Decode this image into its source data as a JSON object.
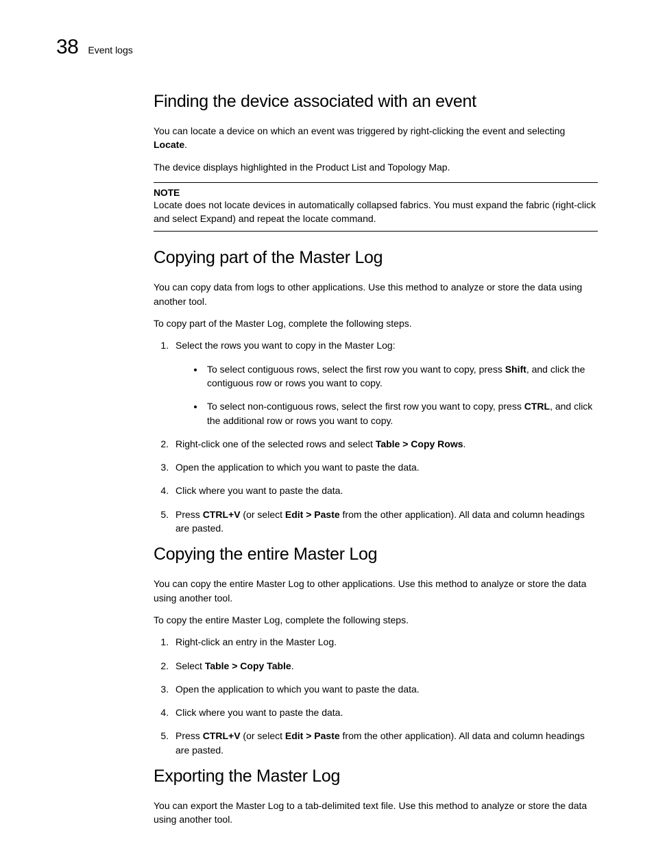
{
  "header": {
    "pageNumber": "38",
    "sectionTitle": "Event logs"
  },
  "sections": {
    "finding": {
      "heading": "Finding the device associated with an event",
      "p1a": "You can locate a device on which an event was triggered by right-clicking the event and selecting ",
      "p1b": "Locate",
      "p1c": ".",
      "p2": "The device displays highlighted in the Product List and Topology Map.",
      "noteLabel": "NOTE",
      "noteText": "Locate does not locate devices in automatically collapsed fabrics. You must expand the fabric (right-click and select Expand) and repeat the locate command."
    },
    "copyPart": {
      "heading": "Copying part of the Master Log",
      "intro1": "You can copy data from logs to other applications. Use this method to analyze or store the data using another tool.",
      "intro2": "To copy part of the Master Log, complete the following steps.",
      "step1": "Select the rows you want to copy in the Master Log:",
      "bullet1a": "To select contiguous rows, select the first row you want to copy, press ",
      "bullet1b": "Shift",
      "bullet1c": ", and click the contiguous row or rows you want to copy.",
      "bullet2a": "To select non-contiguous rows, select the first row you want to copy, press ",
      "bullet2b": "CTRL",
      "bullet2c": ", and click the additional row or rows you want to copy.",
      "step2a": "Right-click one of the selected rows and select ",
      "step2b": "Table > Copy Rows",
      "step2c": ".",
      "step3": "Open the application to which you want to paste the data.",
      "step4": "Click where you want to paste the data.",
      "step5a": "Press ",
      "step5b": "CTRL+V",
      "step5c": " (or select ",
      "step5d": "Edit > Paste",
      "step5e": " from the other application). All data and column headings are pasted."
    },
    "copyEntire": {
      "heading": "Copying the entire Master Log",
      "intro1": "You can copy the entire Master Log to other applications. Use this method to analyze or store the data using another tool.",
      "intro2": "To copy the entire Master Log, complete the following steps.",
      "step1": "Right-click an entry in the Master Log.",
      "step2a": "Select ",
      "step2b": "Table > Copy Table",
      "step2c": ".",
      "step3": "Open the application to which you want to paste the data.",
      "step4": "Click where you want to paste the data.",
      "step5a": "Press ",
      "step5b": "CTRL+V",
      "step5c": " (or select ",
      "step5d": "Edit > Paste",
      "step5e": " from the other application). All data and column headings are pasted."
    },
    "exporting": {
      "heading": "Exporting the Master Log",
      "intro1": "You can export the Master Log to a tab-delimited text file. Use this method to analyze or store the data using another tool."
    }
  }
}
